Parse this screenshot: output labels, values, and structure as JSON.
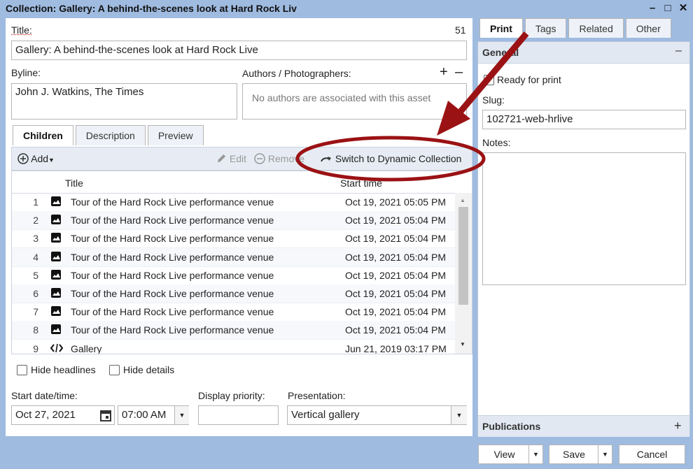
{
  "window": {
    "title": "Collection: Gallery: A behind-the-scenes look at Hard Rock Liv",
    "minimize": "–",
    "maximize": "□",
    "close": "✕"
  },
  "form": {
    "title_label": "Title:",
    "title_count": "51",
    "title_value": "Gallery: A behind-the-scenes look at Hard Rock Live",
    "byline_label": "Byline:",
    "byline_value": "John J. Watkins, The Times",
    "authors_label": "Authors / Photographers:",
    "authors_add": "+",
    "authors_remove": "–",
    "authors_empty": "No authors are associated with this asset"
  },
  "tabs": [
    "Children",
    "Description",
    "Preview"
  ],
  "toolbar": {
    "add": "Add",
    "edit": "Edit",
    "remove": "Remove",
    "switch": "Switch to Dynamic Collection"
  },
  "grid": {
    "columns": [
      "Title",
      "Start time"
    ],
    "rows": [
      {
        "num": "1",
        "icon": "image-icon",
        "title": "Tour of the Hard Rock Live performance venue",
        "date": "Oct 19, 2021 05:05 PM"
      },
      {
        "num": "2",
        "icon": "image-icon",
        "title": "Tour of the Hard Rock Live performance venue",
        "date": "Oct 19, 2021 05:04 PM"
      },
      {
        "num": "3",
        "icon": "image-icon",
        "title": "Tour of the Hard Rock Live performance venue",
        "date": "Oct 19, 2021 05:04 PM"
      },
      {
        "num": "4",
        "icon": "image-icon",
        "title": "Tour of the Hard Rock Live performance venue",
        "date": "Oct 19, 2021 05:04 PM"
      },
      {
        "num": "5",
        "icon": "image-icon",
        "title": "Tour of the Hard Rock Live performance venue",
        "date": "Oct 19, 2021 05:04 PM"
      },
      {
        "num": "6",
        "icon": "image-icon",
        "title": "Tour of the Hard Rock Live performance venue",
        "date": "Oct 19, 2021 05:04 PM"
      },
      {
        "num": "7",
        "icon": "image-icon",
        "title": "Tour of the Hard Rock Live performance venue",
        "date": "Oct 19, 2021 05:04 PM"
      },
      {
        "num": "8",
        "icon": "image-icon",
        "title": "Tour of the Hard Rock Live performance venue",
        "date": "Oct 19, 2021 05:04 PM"
      },
      {
        "num": "9",
        "icon": "code-icon",
        "title": "Gallery",
        "date": "Jun 21, 2019 03:17 PM"
      }
    ]
  },
  "options": {
    "hide_headlines": "Hide headlines",
    "hide_details": "Hide details"
  },
  "schedule": {
    "start_label": "Start date/time:",
    "start_date": "Oct 27, 2021",
    "start_time": "07:00 AM",
    "priority_label": "Display priority:",
    "priority_value": "",
    "presentation_label": "Presentation:",
    "presentation_value": "Vertical gallery"
  },
  "right": {
    "tabs": [
      "Print",
      "Tags",
      "Related",
      "Other"
    ],
    "general": "General",
    "general_toggle": "–",
    "ready": "Ready for print",
    "slug_label": "Slug:",
    "slug_value": "102721-web-hrlive",
    "notes_label": "Notes:",
    "publications": "Publications",
    "publications_add": "+"
  },
  "buttons": {
    "view": "View",
    "save": "Save",
    "cancel": "Cancel"
  },
  "colors": {
    "annotation": "#9b1214",
    "chrome": "#9fbbe0"
  }
}
